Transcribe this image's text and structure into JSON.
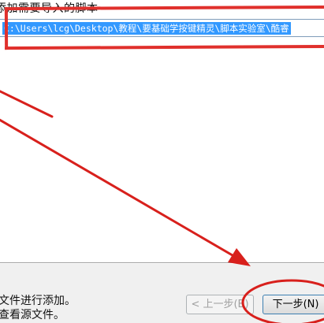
{
  "instruction": "添加需要导入的脚本",
  "path_field": {
    "value": "C:\\Users\\lcg\\Desktop\\教程\\要基础学按键精灵\\脚本实验室\\酷睿"
  },
  "footer": {
    "help_line1": "文件进行添加。",
    "help_line2": "查看源文件。",
    "back_label": "< 上一步(B)",
    "next_label": "下一步(N)"
  },
  "annotation_color": "#e0302c",
  "selection_color": "#3399ff"
}
